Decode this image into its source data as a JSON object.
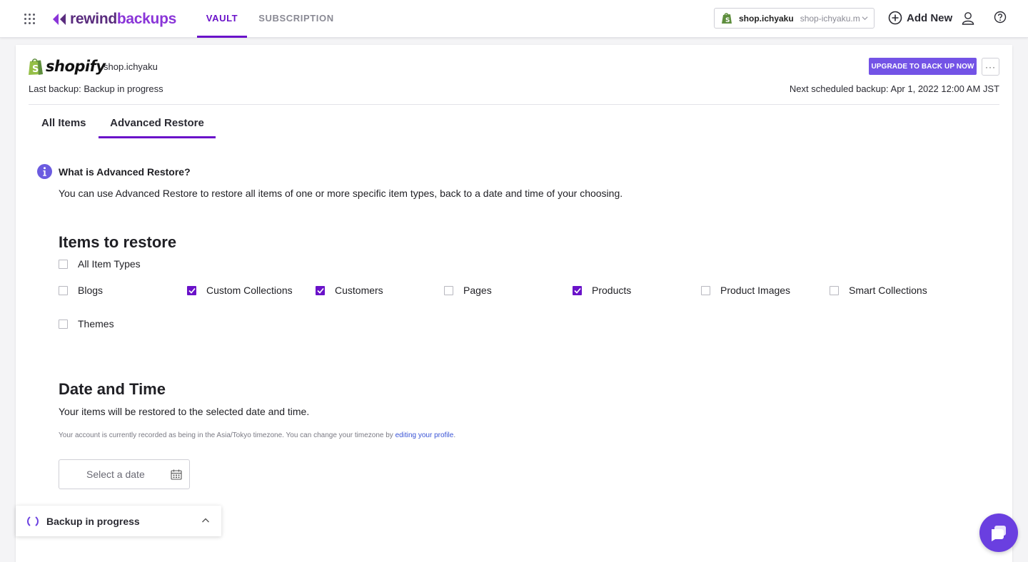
{
  "topbar": {
    "brand_part1": "rewind",
    "brand_part2": "backups",
    "tabs": [
      {
        "label": "VAULT",
        "active": true
      },
      {
        "label": "SUBSCRIPTION",
        "active": false
      }
    ],
    "store_name": "shop.ichyaku",
    "store_domain": "shop-ichyaku.m",
    "add_new_label": "Add New"
  },
  "header": {
    "platform_logo_text": "shopify",
    "shop_label": "shop.ichyaku",
    "last_backup": "Last backup: Backup in progress",
    "upgrade_button": "UPGRADE TO BACK UP NOW",
    "more_label": "···",
    "next_backup": "Next scheduled backup: Apr 1, 2022 12:00 AM JST"
  },
  "tabs": [
    {
      "label": "All Items",
      "active": false
    },
    {
      "label": "Advanced Restore",
      "active": true
    }
  ],
  "info": {
    "title": "What is Advanced Restore?",
    "description": "You can use Advanced Restore to restore all items of one or more specific item types, back to a date and time of your choosing."
  },
  "items_section": {
    "title": "Items to restore",
    "all_types": {
      "label": "All Item Types",
      "checked": false
    },
    "item_types": [
      {
        "label": "Blogs",
        "checked": false
      },
      {
        "label": "Custom Collections",
        "checked": true
      },
      {
        "label": "Customers",
        "checked": true
      },
      {
        "label": "Pages",
        "checked": false
      },
      {
        "label": "Products",
        "checked": true
      },
      {
        "label": "Product Images",
        "checked": false
      },
      {
        "label": "Smart Collections",
        "checked": false
      },
      {
        "label": "Themes",
        "checked": false
      }
    ]
  },
  "date_section": {
    "title": "Date and Time",
    "subtitle": "Your items will be restored to the selected date and time.",
    "tz_note": "Your account is currently recorded as being in the Asia/Tokyo timezone. You can change your timezone by ",
    "tz_link": "editing your profile",
    "tz_end": ".",
    "date_placeholder": "Select a date"
  },
  "toast": {
    "label": "Backup in progress"
  },
  "colors": {
    "accent": "#6a12c9",
    "upgrade": "#7353e6",
    "chat": "#6a3fe0"
  },
  "icons": [
    "apps-grid-icon",
    "rewind-logo-icon",
    "shopify-bag-icon",
    "chevron-down-icon",
    "plus-circle-icon",
    "user-icon",
    "help-icon",
    "info-icon",
    "calendar-icon",
    "spinner-icon",
    "chevron-up-icon",
    "chat-icon"
  ]
}
